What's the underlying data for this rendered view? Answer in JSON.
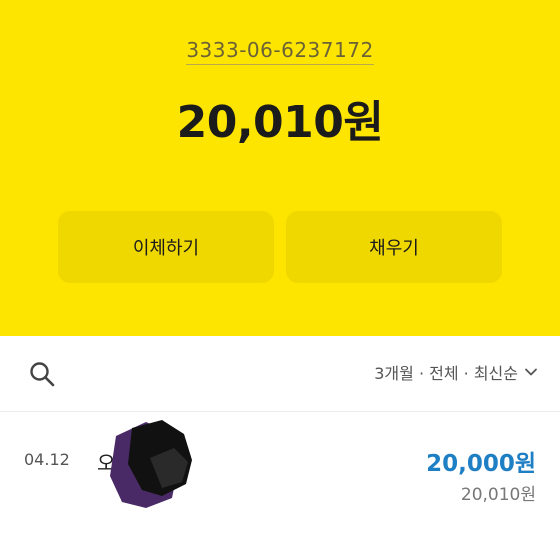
{
  "account": {
    "number": "3333-06-6237172",
    "balance": "20,010원"
  },
  "buttons": {
    "transfer": "이체하기",
    "charge": "채우기"
  },
  "filter": {
    "label": "3개월 · 전체 · 최신순",
    "icon": "chevron-down-icon"
  },
  "search": {
    "icon": "search-icon"
  },
  "transactions": [
    {
      "date": "04.12",
      "name": "오",
      "amount": "20,000원",
      "balance_after": "20,010원"
    }
  ],
  "colors": {
    "accent_yellow": "#FEE500",
    "amount_blue": "#1f7fc4"
  }
}
